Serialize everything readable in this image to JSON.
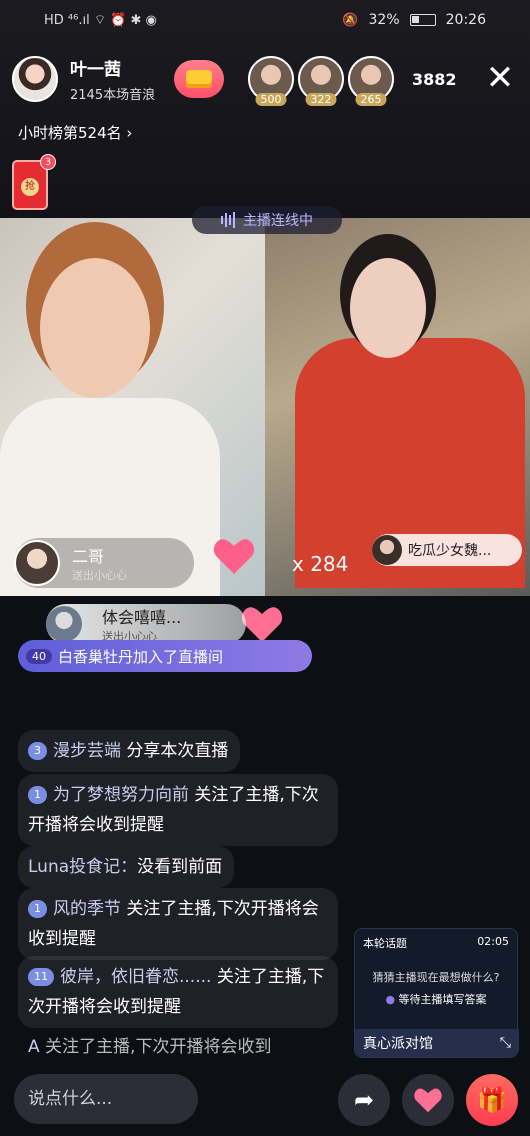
{
  "status_bar": {
    "left_icons": "HD ⁴⁶.ıl ⌔ ⏰ ✱ ◉",
    "battery": "32%",
    "time": "20:26"
  },
  "anchor": {
    "name": "叶一茜",
    "subtitle": "2145本场音浪"
  },
  "viewers": [
    {
      "count": "500"
    },
    {
      "count": "322"
    },
    {
      "count": "265"
    }
  ],
  "viewer_count": "3882",
  "close_label": "✕",
  "rank_text": "小时榜第524名",
  "redpacket": {
    "label": "抢",
    "count": "3"
  },
  "connect_tag": "主播连线中",
  "guest_left": {
    "name": "二哥",
    "sub": "送出小心心"
  },
  "guest_right": {
    "name": "吃瓜少女魏..."
  },
  "score": "x 284",
  "gift_banner": {
    "name": "体会嘻嘻...",
    "sub": "送出小心心"
  },
  "join_bar": {
    "level": "40",
    "text": "白香巢牡丹加入了直播间"
  },
  "chat": [
    {
      "level": "3",
      "user": "漫步芸端",
      "body": "分享本次直播"
    },
    {
      "level": "1",
      "user": "为了梦想努力向前",
      "body": "关注了主播,下次开播将会收到提醒"
    },
    {
      "level": "",
      "user": "Luna投食记：",
      "body": "没看到前面"
    },
    {
      "level": "1",
      "user": "风的季节",
      "body": "关注了主播,下次开播将会收到提醒"
    },
    {
      "level": "11",
      "user": "彼岸，依旧眷恋......",
      "body": "关注了主播,下次开播将会收到提醒"
    },
    {
      "level": "",
      "user": "A",
      "body": "关注了主播,下次开播将会收到"
    }
  ],
  "topic": {
    "title": "本轮话题",
    "time": "02:05",
    "question": "猜猜主播现在最想做什么?",
    "answer": "等待主播填写答案",
    "footer": "真心派对馆"
  },
  "input_placeholder": "说点什么..."
}
